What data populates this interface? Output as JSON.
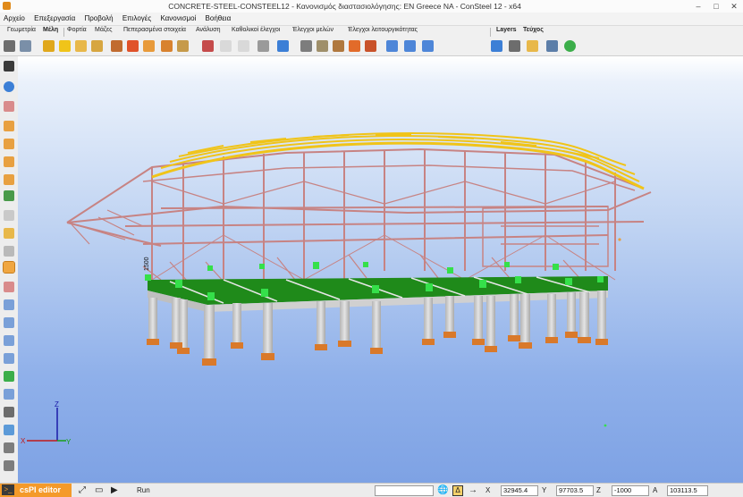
{
  "window": {
    "title": "CONCRETE-STEEL-CONSTEEL12 - Κανονισμός διαστασιολόγησης: EN Greece NA - ConSteel 12 - x64",
    "icon": "consteel-app-icon"
  },
  "menu": [
    "Αρχείο",
    "Επεξεργασία",
    "Προβολή",
    "Επιλογές",
    "Κανονισμοί",
    "Βοήθεια"
  ],
  "ribbon_tabs": [
    "Γεωμετρία",
    "Μέλη",
    "Φορτία",
    "Μάζες",
    "Πεπερασμένα στοιχεία",
    "Ανάλυση",
    "Καθολικοί έλεγχοι",
    "Έλεγχοι μελών",
    "Έλεγχοι λειτουργικότητας"
  ],
  "right_tabs": [
    "Layers",
    "Τεύχος"
  ],
  "axes": {
    "z": "Z",
    "x": "X",
    "y": "Y"
  },
  "label_1500": "1500",
  "status": {
    "cspi_label": "csPI editor",
    "run_label": "Run",
    "x_label": "X",
    "x_value": "32945.4",
    "y_label": "Y",
    "y_value": "97703.5",
    "z_label": "Z",
    "z_value": "-1000",
    "w_label": "A",
    "w_value": "103113.5"
  },
  "colors": {
    "viewport_top": "#ffffff",
    "viewport_bottom": "#7ea2e4",
    "steel_frame": "#c78383",
    "roof": "#f0c419",
    "slab": "#1f8a1a",
    "column": "#d9d9d9",
    "footing": "#d9792a",
    "connector": "#35e04a",
    "accent": "#f49a2a"
  }
}
